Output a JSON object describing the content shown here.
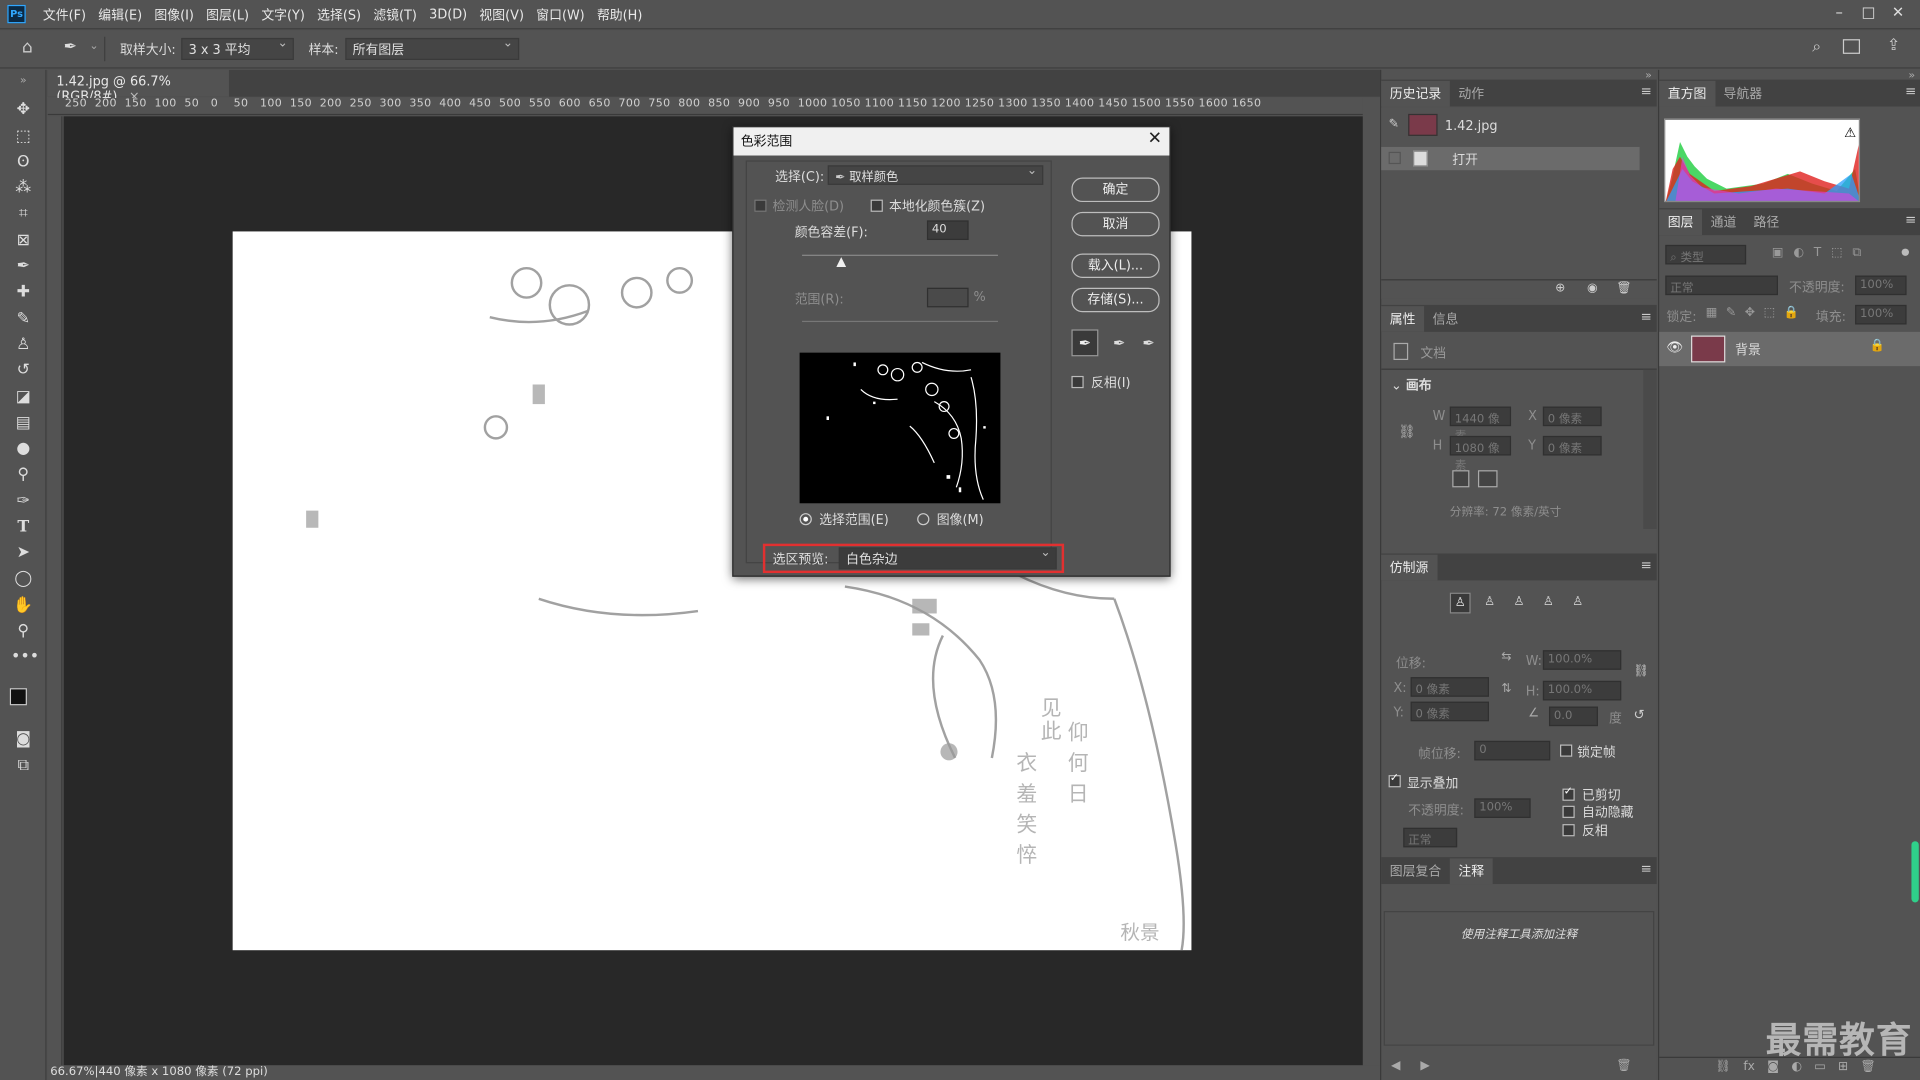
{
  "app": {
    "logo": "Ps"
  },
  "menu": [
    "文件(F)",
    "编辑(E)",
    "图像(I)",
    "图层(L)",
    "文字(Y)",
    "选择(S)",
    "滤镜(T)",
    "3D(D)",
    "视图(V)",
    "窗口(W)",
    "帮助(H)"
  ],
  "options": {
    "sample_size_label": "取样大小:",
    "sample_size_value": "3 x 3 平均",
    "sample_label": "样本:",
    "sample_value": "所有图层"
  },
  "document": {
    "tab": "1.42.jpg @ 66.7%(RGB/8#)",
    "status": "66.67%|440 像素 x 1080 像素 (72 ppi)"
  },
  "ruler": "250  200  150  100  50   0    50   100  150  200  250  300  350  400  450  500  550  600  650  700  750  800  850  900  950  1000 1050 1100 1150 1200 1250 1300 1350 1400 1450 1500 1550 1600 1650",
  "dialog": {
    "title": "色彩范围",
    "select_label": "选择(C):",
    "select_value": "取样颜色",
    "detect_faces": "检测人脸(D)",
    "localized": "本地化颜色簇(Z)",
    "fuzziness_label": "颜色容差(F):",
    "fuzziness_value": "40",
    "fuzziness_fraction": 0.2,
    "range_label": "范围(R):",
    "range_unit": "%",
    "radio_selection": "选择范围(E)",
    "radio_image": "图像(M)",
    "ok": "确定",
    "cancel": "取消",
    "load": "载入(L)...",
    "save": "存储(S)...",
    "invert": "反相(I)",
    "preview_label": "选区预览:",
    "preview_value": "白色杂边"
  },
  "history": {
    "tabs": [
      "历史记录",
      "动作"
    ],
    "snapshot": "1.42.jpg",
    "items": [
      "打开"
    ]
  },
  "properties": {
    "tabs": [
      "属性",
      "信息"
    ],
    "doc_label": "文档",
    "section": "画布",
    "w_label": "W",
    "w_value": "1440 像素",
    "h_label": "H",
    "h_value": "1080 像素",
    "x_label": "X",
    "x_value": "0 像素",
    "y_label": "Y",
    "y_value": "0 像素",
    "resolution": "分辨率: 72 像素/英寸"
  },
  "clone": {
    "tab": "仿制源",
    "offset_label": "位移:",
    "x_label": "X:",
    "x_value": "0 像素",
    "y_label": "Y:",
    "y_value": "0 像素",
    "w_label": "W:",
    "w_value": "100.0%",
    "h_label": "H:",
    "h_value": "100.0%",
    "angle_value": "0.0",
    "angle_unit": "度",
    "frame_offset_label": "帧位移:",
    "frame_offset_value": "0",
    "lock_frame": "锁定帧",
    "show_overlay": "显示叠加",
    "opacity_label": "不透明度:",
    "opacity_value": "100%",
    "mode_value": "正常",
    "clipped": "已剪切",
    "auto_hide": "自动隐藏",
    "invert": "反相"
  },
  "notes": {
    "tabs": [
      "图层复合",
      "注释"
    ],
    "hint": "使用注释工具添加注释"
  },
  "histogram": {
    "tabs": [
      "直方图",
      "导航器"
    ]
  },
  "layers": {
    "tabs": [
      "图层",
      "通道",
      "路径"
    ],
    "filter_placeholder": "类型",
    "blend": "正常",
    "opacity_label": "不透明度:",
    "opacity_value": "100%",
    "lock_label": "锁定:",
    "fill_label": "填充:",
    "fill_value": "100%",
    "layer_name": "背景"
  },
  "watermark": "最需教育",
  "colors": {
    "accent": "#31a8ff",
    "highlight_box": "#e23030",
    "panel_bg": "#535353",
    "canvas_bg": "#282828"
  }
}
